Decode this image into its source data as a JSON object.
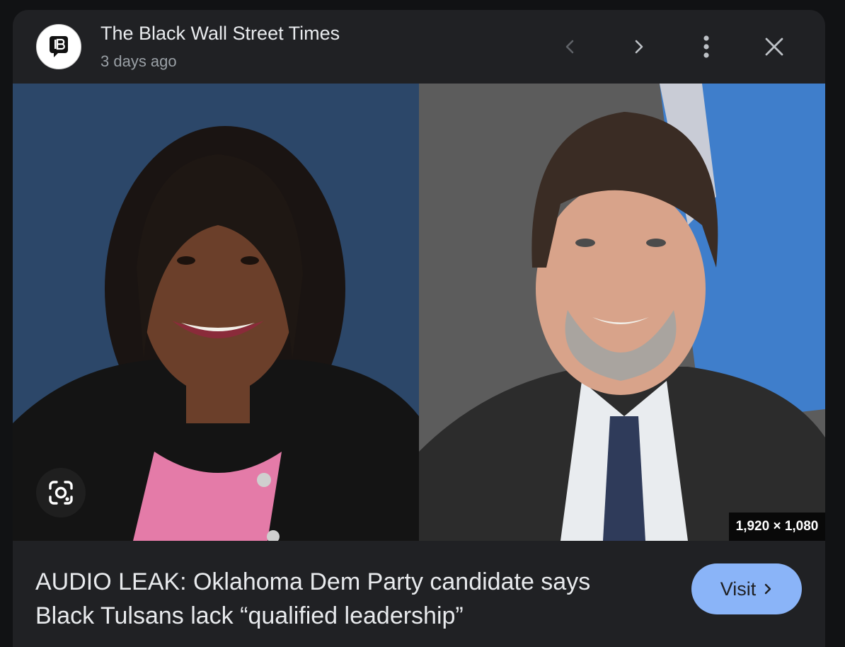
{
  "header": {
    "source_name": "The Black Wall Street Times",
    "source_time": "3 days ago",
    "logo_icon": "black-wall-street-times-logo",
    "prev_icon": "chevron-left-icon",
    "next_icon": "chevron-right-icon",
    "more_icon": "more-vert-icon",
    "close_icon": "close-icon"
  },
  "image": {
    "dimensions": "1,920 × 1,080",
    "lens_icon": "google-lens-icon"
  },
  "caption": {
    "title": "AUDIO LEAK: Oklahoma Dem Party candidate says Black Tulsans lack “qualified leadership”"
  },
  "actions": {
    "visit_label": "Visit",
    "visit_icon": "chevron-right-icon"
  },
  "colors": {
    "panel_bg": "#202124",
    "accent": "#8ab4f8",
    "text_primary": "#e8eaed",
    "text_secondary": "#9aa0a6",
    "left_photo_bg": "#2c4769"
  }
}
